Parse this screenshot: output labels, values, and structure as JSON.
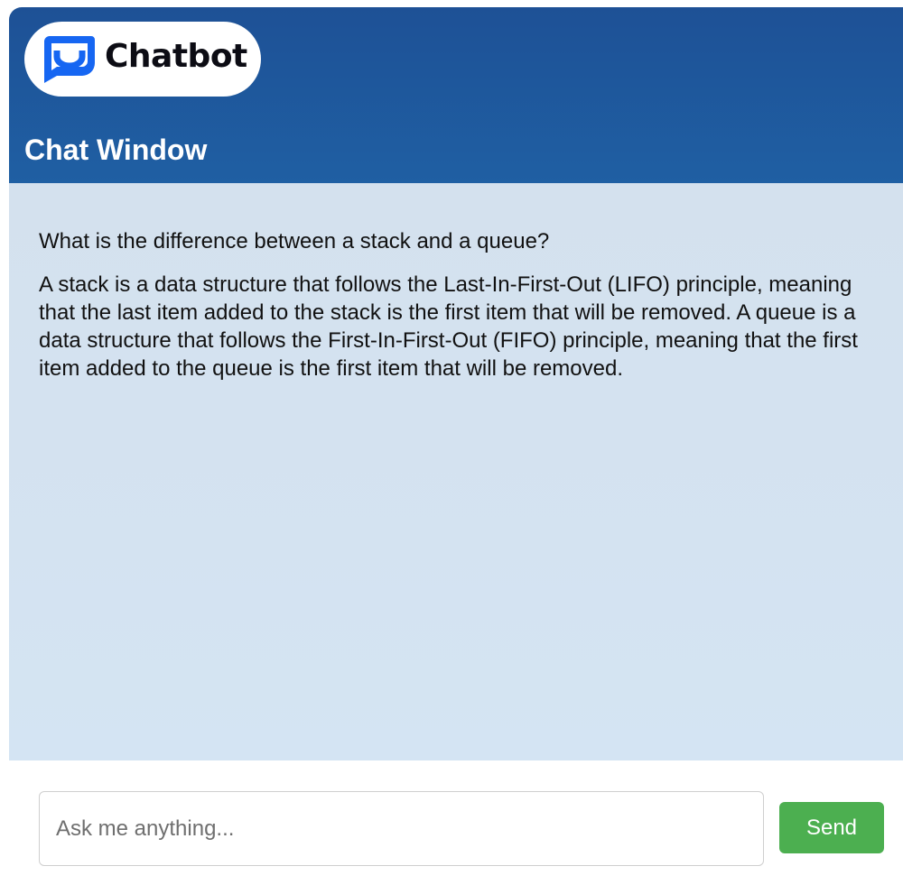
{
  "app": {
    "logo_text": "Chatbot",
    "logo_icon": "chat-bubble-smile-icon"
  },
  "header": {
    "title": "Chat Window"
  },
  "messages": [
    {
      "role": "user",
      "text": "What is the difference between a stack and a queue?"
    },
    {
      "role": "bot",
      "text": "A stack is a data structure that follows the Last-In-First-Out (LIFO) principle, meaning that the last item added to the stack is the first item that will be removed. A queue is a data structure that follows the First-In-First-Out (FIFO) principle, meaning that the first item added to the queue is the first item that will be removed."
    }
  ],
  "composer": {
    "placeholder": "Ask me anything...",
    "value": "",
    "send_label": "Send"
  },
  "colors": {
    "header": "#1f5a9e",
    "chat_background": "#d4e2f1",
    "logo_blue": "#1666f2",
    "send_button": "#4caf50"
  }
}
